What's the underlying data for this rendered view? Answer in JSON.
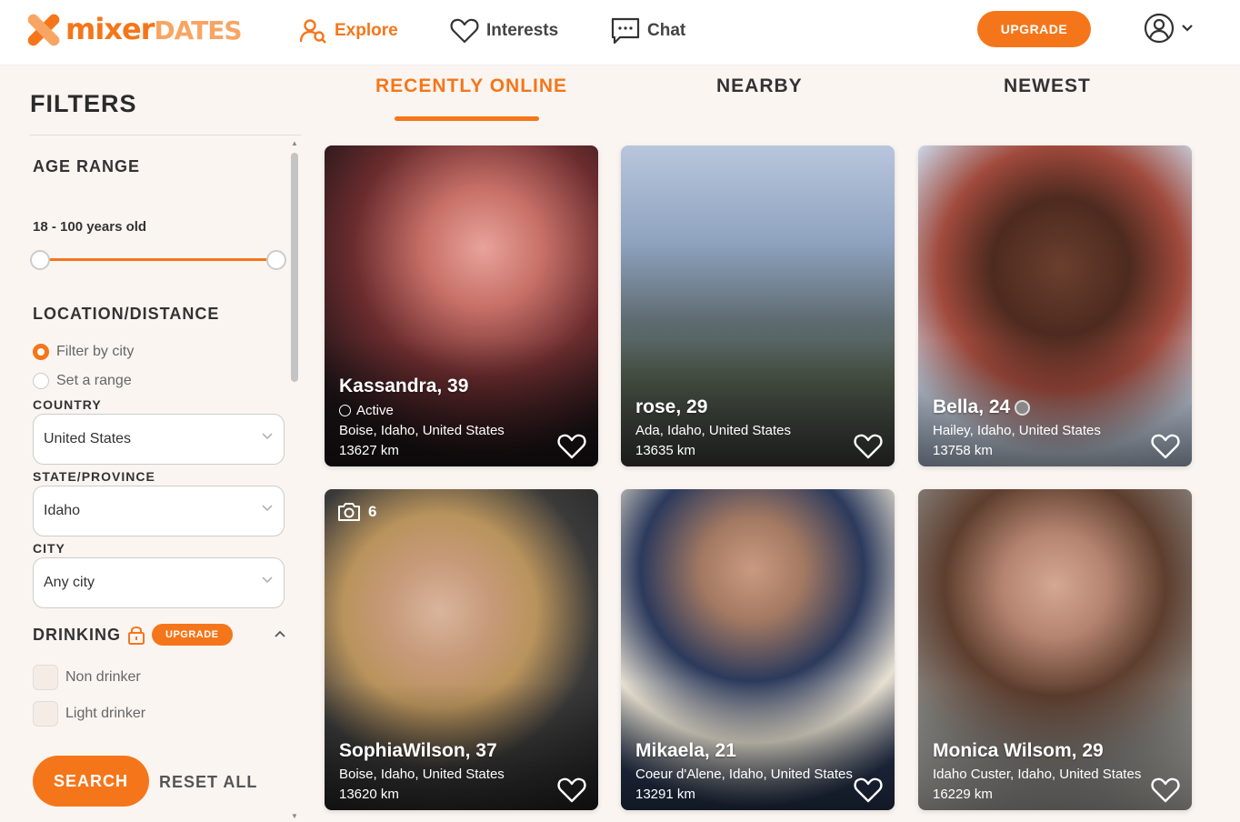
{
  "brand": {
    "logo_main": "mixer",
    "logo_sub": "DATES"
  },
  "nav": {
    "explore": "Explore",
    "interests": "Interests",
    "chat": "Chat",
    "upgrade": "UPGRADE"
  },
  "filters": {
    "title": "FILTERS",
    "age_range_title": "AGE RANGE",
    "age_value": "18 - 100 years old",
    "location_title": "LOCATION/DISTANCE",
    "radio_city": "Filter by city",
    "radio_range": "Set a range",
    "country_label": "COUNTRY",
    "country_value": "United States",
    "state_label": "STATE/PROVINCE",
    "state_value": "Idaho",
    "city_label": "CITY",
    "city_value": "Any city",
    "drinking_title": "DRINKING",
    "drinking_upgrade": "UPGRADE",
    "drinking_options": [
      "Non drinker",
      "Light drinker"
    ],
    "search": "SEARCH",
    "reset": "RESET ALL"
  },
  "tabs": [
    "RECENTLY ONLINE",
    "NEARBY",
    "NEWEST"
  ],
  "profiles": [
    {
      "name": "Kassandra, 39",
      "status": "Active",
      "location": "Boise, Idaho, United States",
      "distance": "13627 km"
    },
    {
      "name": "rose, 29",
      "location": "Ada, Idaho, United States",
      "distance": "13635 km"
    },
    {
      "name": "Bella, 24",
      "location": "Hailey, Idaho, United States",
      "distance": "13758 km"
    },
    {
      "name": "SophiaWilson, 37",
      "photo_count": "6",
      "location": "Boise, Idaho, United States",
      "distance": "13620 km"
    },
    {
      "name": "Mikaela, 21",
      "location": "Coeur d'Alene, Idaho, United States",
      "distance": "13291 km"
    },
    {
      "name": "Monica Wilsom, 29",
      "location": "Idaho Custer, Idaho, United States",
      "distance": "16229 km"
    }
  ],
  "colors": {
    "accent": "#f5761a",
    "accent_light": "#f8a564",
    "background": "#fbf5f1"
  }
}
